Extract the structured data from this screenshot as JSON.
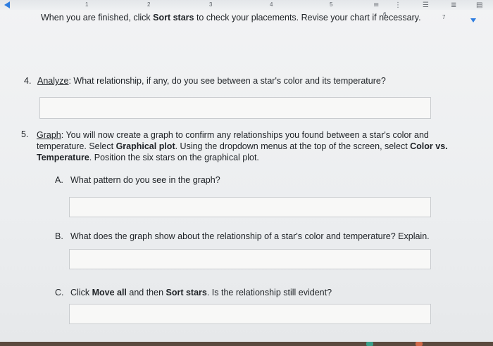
{
  "toolbar": {
    "ruler_numbers": [
      "1",
      "2",
      "3",
      "4",
      "5",
      "6",
      "7"
    ],
    "icons": [
      "back-arrow-icon",
      "list-icon",
      "align-icon",
      "bullets-icon",
      "menu-icon",
      "expand-icon"
    ]
  },
  "instructions": {
    "part1": "When you are finished, click ",
    "bold1": "Sort stars",
    "part2": " to check your placements. Revise your chart if necessary."
  },
  "q4": {
    "number": "4.",
    "label": "Analyze",
    "text": ": What relationship, if any, do you see between a star's color and its temperature?",
    "answer": ""
  },
  "q5": {
    "number": "5.",
    "label": "Graph",
    "line1": ": You will now create a graph to confirm any relationships you found between a star's color and",
    "line2_a": "temperature. Select ",
    "line2_b": "Graphical plot",
    "line2_c": ". Using the dropdown menus at the top of the screen, select ",
    "line2_d": "Color vs.",
    "line3_a": "Temperature",
    "line3_b": ". Position the six stars on the graphical plot.",
    "a_letter": "A.",
    "a_text": "What pattern do you see in the graph?",
    "a_answer": "",
    "b_letter": "B.",
    "b_text": "What does the graph show about the relationship of a star's color and temperature? Explain.",
    "b_answer": "",
    "c_letter": "C.",
    "c_a": "Click ",
    "c_b": "Move all",
    "c_c": " and then ",
    "c_d": "Sort stars",
    "c_e": ". Is the relationship still evident?",
    "c_answer": ""
  },
  "colors": {
    "accent": "#2d7de0",
    "text": "#1e2226",
    "field_border": "#c9cccf"
  }
}
